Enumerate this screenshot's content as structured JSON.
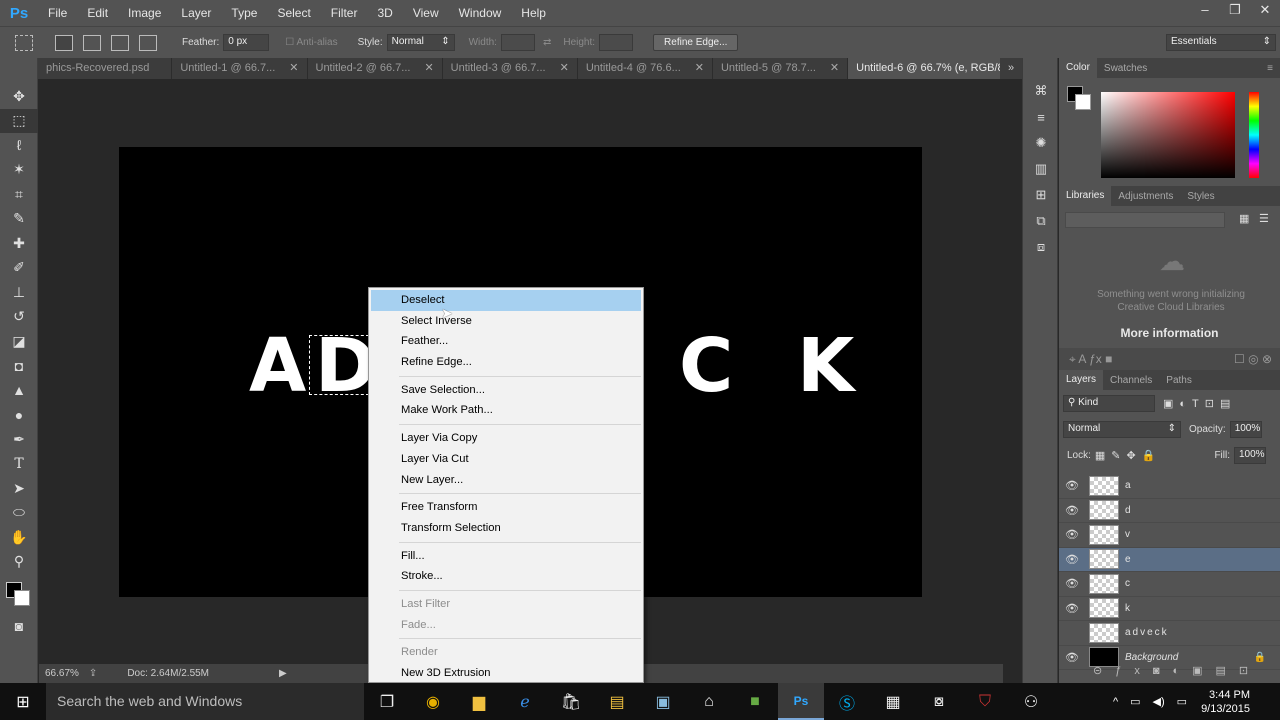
{
  "app": {
    "logo": "Ps",
    "menus": [
      "File",
      "Edit",
      "Image",
      "Layer",
      "Type",
      "Select",
      "Filter",
      "3D",
      "View",
      "Window",
      "Help"
    ],
    "window_controls": [
      "–",
      "❐",
      "✕"
    ]
  },
  "options": {
    "feather_label": "Feather:",
    "feather_value": "0 px",
    "antialias_label": "Anti-alias",
    "style_label": "Style:",
    "style_value": "Normal",
    "width_label": "Width:",
    "height_label": "Height:",
    "refine_edge": "Refine Edge...",
    "workspace": "Essentials"
  },
  "tabs": [
    {
      "label": "phics-Recovered.psd",
      "close": ""
    },
    {
      "label": "Untitled-1 @ 66.7...",
      "close": "✕"
    },
    {
      "label": "Untitled-2 @ 66.7...",
      "close": "✕"
    },
    {
      "label": "Untitled-3 @ 66.7...",
      "close": "✕"
    },
    {
      "label": "Untitled-4 @ 76.6...",
      "close": "✕"
    },
    {
      "label": "Untitled-5 @ 78.7...",
      "close": "✕"
    },
    {
      "label": "Untitled-6 @ 66.7% (e, RGB/8) *",
      "close": "✕"
    }
  ],
  "tabs_overflow": "»",
  "canvas": {
    "letters": [
      "A",
      "D",
      "C",
      "K"
    ]
  },
  "status": {
    "zoom": "66.67%",
    "doc": "Doc: 2.64M/2.55M",
    "arrow": "▶"
  },
  "context_menu": {
    "groups": [
      [
        {
          "label": "Deselect",
          "highlighted": true
        },
        {
          "label": "Select Inverse"
        },
        {
          "label": "Feather..."
        },
        {
          "label": "Refine Edge..."
        }
      ],
      [
        {
          "label": "Save Selection..."
        },
        {
          "label": "Make Work Path..."
        }
      ],
      [
        {
          "label": "Layer Via Copy"
        },
        {
          "label": "Layer Via Cut"
        },
        {
          "label": "New Layer..."
        }
      ],
      [
        {
          "label": "Free Transform"
        },
        {
          "label": "Transform Selection"
        }
      ],
      [
        {
          "label": "Fill..."
        },
        {
          "label": "Stroke..."
        }
      ],
      [
        {
          "label": "Last Filter",
          "disabled": true
        },
        {
          "label": "Fade...",
          "disabled": true
        }
      ],
      [
        {
          "label": "Render",
          "disabled": true
        },
        {
          "label": "New 3D Extrusion"
        }
      ]
    ]
  },
  "panels": {
    "color_tabs": [
      "Color",
      "Swatches"
    ],
    "library_tabs": [
      "Libraries",
      "Adjustments",
      "Styles"
    ],
    "library_error": "Something went wrong initializing Creative Cloud Libraries",
    "more_info": "More information",
    "layers_tabs": [
      "Layers",
      "Channels",
      "Paths"
    ],
    "kind_label": "Kind",
    "blend_mode": "Normal",
    "opacity_label": "Opacity:",
    "opacity_value": "100%",
    "lock_label": "Lock:",
    "fill_label": "Fill:",
    "fill_value": "100%",
    "layers": [
      {
        "name": "a",
        "visible": true,
        "selected": false
      },
      {
        "name": "d",
        "visible": true,
        "selected": false
      },
      {
        "name": "v",
        "visible": true,
        "selected": false
      },
      {
        "name": "e",
        "visible": true,
        "selected": true
      },
      {
        "name": "c",
        "visible": true,
        "selected": false
      },
      {
        "name": "k",
        "visible": true,
        "selected": false
      },
      {
        "name": "adveck",
        "visible": false,
        "selected": false
      },
      {
        "name": "Background",
        "visible": true,
        "selected": false,
        "locked": true
      }
    ]
  },
  "taskbar": {
    "search_placeholder": "Search the web and Windows",
    "time": "3:44 PM",
    "date": "9/13/2015"
  }
}
